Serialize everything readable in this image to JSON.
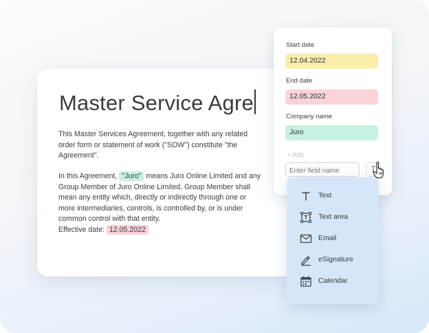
{
  "document": {
    "title": "Master Service Agre",
    "para1": "This  Master Services  Agreement,  together with any related order form or statement of work (\"SOW\") constitute \"the Agreement\".",
    "para2_before": "In this Agreement, ",
    "para2_chip": "\"Juro\"",
    "para2_after": " means Juro Online Limited and any Group Member of Juro Online Limited. Group Member shall mean any entity which, directly or indirectly through one or more intermediaries, controls, is controlled by, or is under common control with that entity.",
    "effective_label": "Effective date: ",
    "effective_value": "12.05.2022"
  },
  "fields_panel": {
    "fields": [
      {
        "label": "Start date",
        "value": "12.04.2022",
        "color": "#fbeeaa"
      },
      {
        "label": "End date",
        "value": "12.05.2022",
        "color": "#f9d3d8"
      },
      {
        "label": "Company name",
        "value": "Juro",
        "color": "#c6f2df"
      }
    ],
    "add_label": "+ Add",
    "input_placeholder": "Enter field name",
    "type_button_label": "T"
  },
  "menu": {
    "items": [
      {
        "label": "Text",
        "icon": "text-icon"
      },
      {
        "label": "Text area",
        "icon": "text-area-icon"
      },
      {
        "label": "Email",
        "icon": "email-icon"
      },
      {
        "label": "eSignature",
        "icon": "pen-icon"
      },
      {
        "label": "Calendar",
        "icon": "calendar-icon"
      }
    ]
  },
  "colors": {
    "highlight_green": "#c7f0e1",
    "highlight_red": "#f8d0d6",
    "menu_bg": "#d5e6f8"
  }
}
